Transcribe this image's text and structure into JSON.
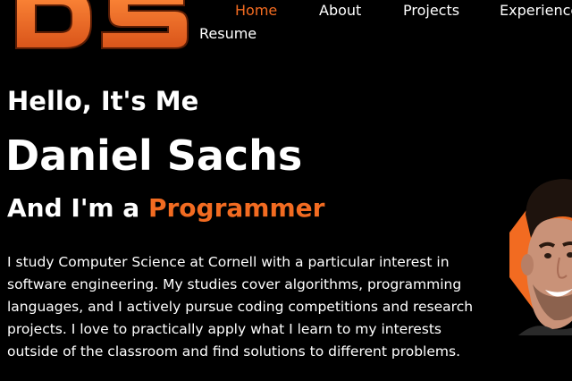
{
  "logo": {
    "text": "DS",
    "icon": "ds-logo-icon",
    "color": "#f26b21"
  },
  "nav": {
    "items": [
      {
        "label": "Home",
        "active": true
      },
      {
        "label": "About",
        "active": false
      },
      {
        "label": "Projects",
        "active": false
      },
      {
        "label": "Experience",
        "active": false
      },
      {
        "label": "Resume",
        "active": false
      }
    ]
  },
  "hero": {
    "greeting": "Hello, It's Me",
    "name": "Daniel Sachs",
    "role_prefix": "And I'm a ",
    "role": "Programmer",
    "bio": "I study Computer Science at Cornell with a particular interest in software engineering. My studies cover algorithms, programming languages, and I actively pursue coding competitions and research projects. I love to practically apply what I learn to my interests outside of the classroom and find solutions to different problems."
  },
  "portrait": {
    "icon": "profile-photo"
  },
  "colors": {
    "accent": "#f26b21",
    "background": "#000000",
    "text": "#ffffff"
  }
}
